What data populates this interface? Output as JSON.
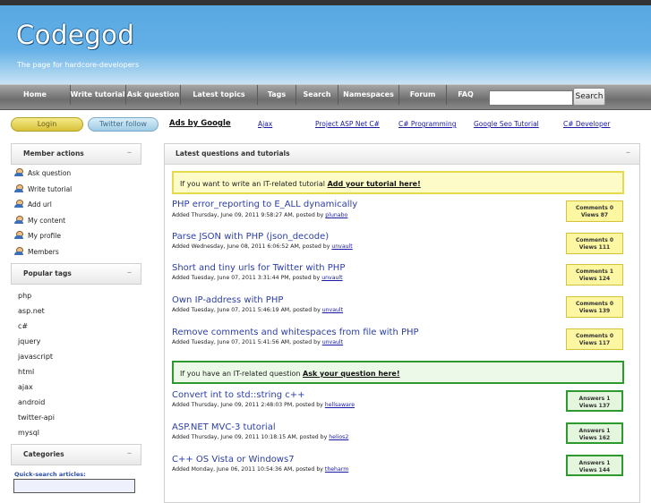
{
  "site": {
    "logo": "Codegod",
    "tagline": "The page for  hardcore-developers"
  },
  "nav": {
    "items": [
      "Home",
      "Write tutorial",
      "Ask question",
      "Latest topics",
      "Tags",
      "Search",
      "Namespaces",
      "Forum",
      "FAQ"
    ],
    "search_value": "",
    "search_button": "Search"
  },
  "topbar": {
    "login": "Login",
    "twitter": "Twitter follow",
    "ads": "Ads by Google",
    "links": [
      "Ajax",
      "Project ASP Net C#",
      "C# Programming",
      "Google Seo Tutorial",
      "C# Developer"
    ]
  },
  "sidebar": {
    "member_actions_title": "Member actions",
    "member_items": [
      "Ask question",
      "Write tutorial",
      "Add url",
      "My content",
      "My profile",
      "Members"
    ],
    "popular_tags_title": "Popular tags",
    "tags": [
      "php",
      "asp.net",
      "c#",
      "jquery",
      "javascript",
      "html",
      "ajax",
      "android",
      "twitter-api",
      "mysql"
    ],
    "categories_title": "Categories",
    "quick_search_label": "Quick-search articles:",
    "collapse_symbol": "–"
  },
  "main": {
    "title": "Latest questions and tutorials",
    "collapse_symbol": "–",
    "tutorial_notice": {
      "text": "If you want to write an IT-related tutorial ",
      "link": "Add your tutorial here!"
    },
    "question_notice": {
      "text": "If you have an IT-related question ",
      "link": "Ask your question here!"
    },
    "tutorials": [
      {
        "title": "PHP error_reporting to E_ALL dynamically",
        "meta": "Added Thursday, June 09, 2011 9:58:27 AM, posted by ",
        "user": "plunabo",
        "count_label": "Comments 0",
        "views": "Views 87"
      },
      {
        "title": "Parse JSON with PHP (json_decode)",
        "meta": "Added Wednesday, June 08, 2011 6:06:52 AM, posted by ",
        "user": "unvault",
        "count_label": "Comments 0",
        "views": "Views 111"
      },
      {
        "title": "Short and tiny urls for Twitter with PHP",
        "meta": "Added Tuesday, June 07, 2011 3:31:44 PM, posted by ",
        "user": "unvault",
        "count_label": "Comments 1",
        "views": "Views 124"
      },
      {
        "title": "Own IP-address with PHP",
        "meta": "Added Tuesday, June 07, 2011 5:46:19 AM, posted by ",
        "user": "unvault",
        "count_label": "Comments 0",
        "views": "Views 139"
      },
      {
        "title": "Remove comments and whitespaces from file with PHP",
        "meta": "Added Tuesday, June 07, 2011 5:41:56 AM, posted by ",
        "user": "unvault",
        "count_label": "Comments 0",
        "views": "Views 117"
      }
    ],
    "questions": [
      {
        "title": "Convert int to std::string c++",
        "meta": "Added Thursday, June 09, 2011 2:48:03 PM, posted by ",
        "user": "hellsaware",
        "count_label": "Answers 1",
        "views": "Views 137"
      },
      {
        "title": "ASP.NET MVC-3 tutorial",
        "meta": "Added Thursday, June 09, 2011 10:18:15 AM, posted by ",
        "user": "helios2",
        "count_label": "Answers 1",
        "views": "Views 162"
      },
      {
        "title": "C++ OS Vista or Windows7",
        "meta": "Added Monday, June 06, 2011 10:54:36 AM, posted by ",
        "user": "theharm",
        "count_label": "Answers 1",
        "views": "Views 144"
      }
    ]
  }
}
